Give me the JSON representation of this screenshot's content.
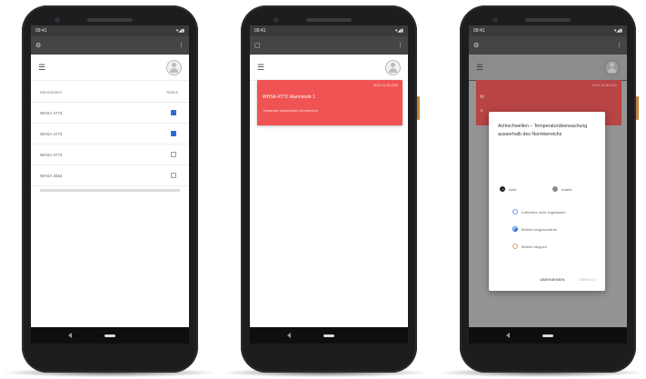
{
  "phones": [
    {
      "status": {
        "time": "09:41",
        "icons": "▾◢▮"
      },
      "table": {
        "col1": "Messstation",
        "col2": "Status",
        "rows": [
          {
            "label": "WHSA 4773",
            "checked": true
          },
          {
            "label": "WHSA 4773",
            "checked": true
          },
          {
            "label": "WHSA 4773",
            "checked": false
          },
          {
            "label": "WHSA 4554",
            "checked": false
          }
        ]
      }
    },
    {
      "status": {
        "time": "09:41",
        "icons": "▾◢▮"
      },
      "alarm": {
        "time": "09:42 14.08.2020",
        "title": "WHSA 4773: Alarmstufe 1",
        "sub": "Temperatur überschreitet Grenzbereich"
      }
    },
    {
      "status": {
        "time": "09:41",
        "icons": "▾◢▮"
      },
      "alarm_fragment": {
        "time": "09:42 14.08.2020",
        "t1": "W",
        "t2": "Te"
      },
      "dialog": {
        "title": "Achtschwellen – Temperaturüberwachung ausserhalb des Normbereichs",
        "opt_left": "Aktiv",
        "opt_right": "Inaktiv",
        "choices": [
          "Luftzufuhr nicht zugelassen",
          "Betrieb eingeschränkt",
          "Betrieb stoppen"
        ],
        "btn_primary": "ÜBERNEHMEN",
        "btn_secondary": "ABBRUCH"
      }
    }
  ],
  "icons": {
    "menu": "☰",
    "back": "◁",
    "more": "⋮",
    "settings": "⚙",
    "calendar": "▢"
  },
  "colors": {
    "alarm_red": "#f05353",
    "checkbox_blue": "#2d6bd6"
  }
}
